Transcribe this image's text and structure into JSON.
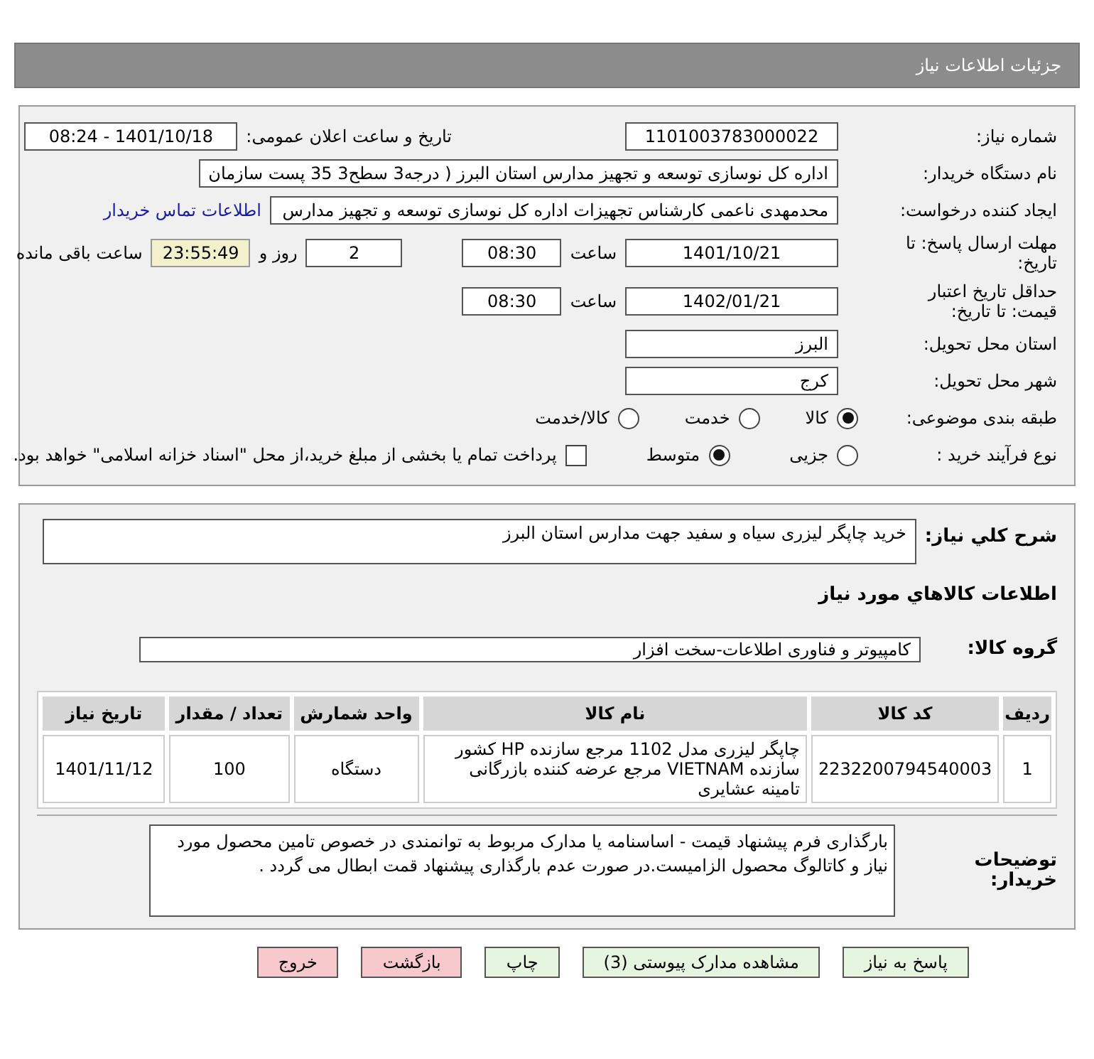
{
  "header": {
    "title": "جزئیات اطلاعات نیاز"
  },
  "need_number": {
    "label": "شماره نیاز:",
    "value": "1101003783000022"
  },
  "announce": {
    "label": "تاریخ و ساعت اعلان عمومی:",
    "value": "1401/10/18 - 08:24"
  },
  "buyer": {
    "label": "نام دستگاه خریدار:",
    "value": "اداره کل نوسازی   توسعه و تجهیز مدارس استان البرز ( درجه3  سطح3  35 پست سازمان"
  },
  "requester": {
    "label": "ایجاد کننده درخواست:",
    "value": "محدمهدی ناعمی کارشناس تجهیزات اداره کل نوسازی   توسعه و تجهیز مدارس",
    "link": "اطلاعات تماس خریدار"
  },
  "deadline": {
    "label": "مهلت ارسال پاسخ: تا تاریخ:",
    "date": "1401/10/21",
    "time_label": "ساعت",
    "time": "08:30",
    "days": "2",
    "days_label": "روز و",
    "remaining": "23:55:49",
    "remaining_label": "ساعت باقی مانده"
  },
  "validity": {
    "label": "حداقل تاریخ اعتبار قیمت: تا تاریخ:",
    "date": "1402/01/21",
    "time_label": "ساعت",
    "time": "08:30"
  },
  "province": {
    "label": "استان محل تحویل:",
    "value": "البرز"
  },
  "city": {
    "label": "شهر محل تحویل:",
    "value": "کرج"
  },
  "category": {
    "label": "طبقه بندی موضوعی:",
    "options": [
      {
        "label": "کالا",
        "selected": true
      },
      {
        "label": "خدمت",
        "selected": false
      },
      {
        "label": "کالا/خدمت",
        "selected": false
      }
    ]
  },
  "process": {
    "label": "نوع فرآیند خرید :",
    "options": [
      {
        "label": "جزیی",
        "selected": false
      },
      {
        "label": "متوسط",
        "selected": true
      }
    ],
    "payment": {
      "label": "پرداخت تمام یا بخشی از مبلغ خرید،از محل \"اسناد خزانه اسلامی\" خواهد بود.",
      "checked": false
    }
  },
  "description": {
    "label": "شرح کلي نياز:",
    "value": "خرید چاپگر لیزری سیاه و سفید جهت مدارس استان البرز"
  },
  "goods_heading": "اطلاعات کالاهاي مورد نياز",
  "goods_group": {
    "label": "گروه کالا:",
    "value": "کامپیوتر و فناوری اطلاعات-سخت افزار"
  },
  "table": {
    "columns": [
      "ردیف",
      "کد کالا",
      "نام کالا",
      "واحد شمارش",
      "تعداد / مقدار",
      "تاریخ نیاز"
    ],
    "rows": [
      [
        "1",
        "2232200794540003",
        "چاپگر لیزری مدل 1102 مرجع سازنده HP کشور سازنده VIETNAM مرجع عرضه کننده بازرگانی تامینه عشایری",
        "دستگاه",
        "100",
        "1401/11/12"
      ]
    ]
  },
  "notes": {
    "label": "توضیحات خریدار:",
    "value": "بارگذاری فرم پیشنهاد قیمت - اساسنامه یا مدارک مربوط به توانمندی در خصوص تامین محصول مورد نیاز و کاتالوگ محصول الزامیست.در صورت عدم بارگذاری پیشنهاد قمت ابطال می گردد ."
  },
  "buttons": [
    {
      "label": "پاسخ به نیاز",
      "kind": "action"
    },
    {
      "label": "مشاهده مدارک پیوستی (3)",
      "kind": "action"
    },
    {
      "label": "چاپ",
      "kind": "action"
    },
    {
      "label": "بازگشت",
      "kind": "nav"
    },
    {
      "label": "خروج",
      "kind": "nav"
    }
  ]
}
